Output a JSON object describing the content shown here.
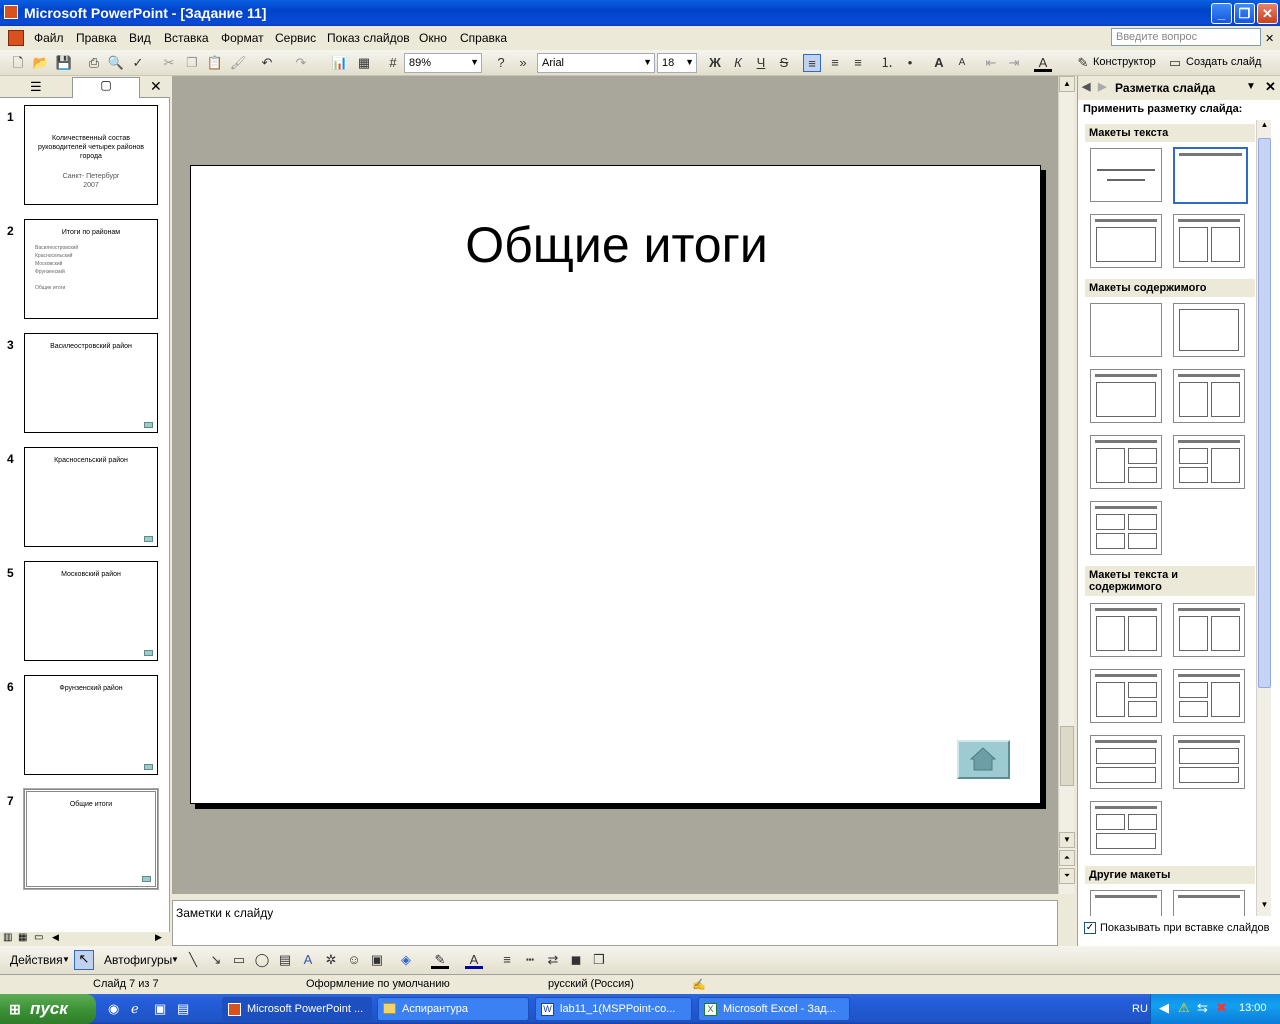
{
  "window": {
    "title": "Microsoft PowerPoint - [Задание 11]",
    "min_label": "_",
    "max_label": "❐",
    "close_label": "✕"
  },
  "menu": [
    "Файл",
    "Правка",
    "Вид",
    "Вставка",
    "Формат",
    "Сервис",
    "Показ слайдов",
    "Окно",
    "Справка"
  ],
  "help_placeholder": "Введите вопрос",
  "toolbar": {
    "zoom": "89%",
    "font": "Arial",
    "font_size": "18",
    "bold": "Ж",
    "italic": "К",
    "underline": "Ч",
    "shadow": "S",
    "designer": "Конструктор",
    "new_slide": "Создать слайд"
  },
  "slides": [
    {
      "num": "1",
      "title": "Количественный состав руководителей четырех районов города",
      "sub1": "Санкт- Петербург",
      "sub2": "2007"
    },
    {
      "num": "2",
      "title": "Итоги по районам",
      "bullets": [
        "Василеостровский",
        "Красносельский",
        "Московский",
        "Фрунзенский",
        "",
        "Общие итоги"
      ]
    },
    {
      "num": "3",
      "title": "Василеостровский район"
    },
    {
      "num": "4",
      "title": "Красносельский район"
    },
    {
      "num": "5",
      "title": "Московский район"
    },
    {
      "num": "6",
      "title": "Фрунзенский район"
    },
    {
      "num": "7",
      "title": "Общие итоги"
    }
  ],
  "current_slide": {
    "title": "Общие итоги"
  },
  "notes_placeholder": "Заметки к слайду",
  "taskpane": {
    "title": "Разметка слайда",
    "apply_label": "Применить разметку слайда:",
    "sections": [
      "Макеты текста",
      "Макеты содержимого",
      "Макеты текста и содержимого",
      "Другие макеты"
    ],
    "checkbox_label": "Показывать при вставке слайдов"
  },
  "drawbar": {
    "actions": "Действия",
    "autoshapes": "Автофигуры"
  },
  "status": {
    "slide": "Слайд 7 из 7",
    "design": "Оформление по умолчанию",
    "language": "русский (Россия)"
  },
  "taskbar": {
    "start": "пуск",
    "tasks": [
      "Microsoft PowerPoint ...",
      "Аспирантура",
      "lab11_1(MSPPoint-co...",
      "Microsoft Excel - Зад..."
    ],
    "lang": "RU",
    "clock": "13:00"
  }
}
